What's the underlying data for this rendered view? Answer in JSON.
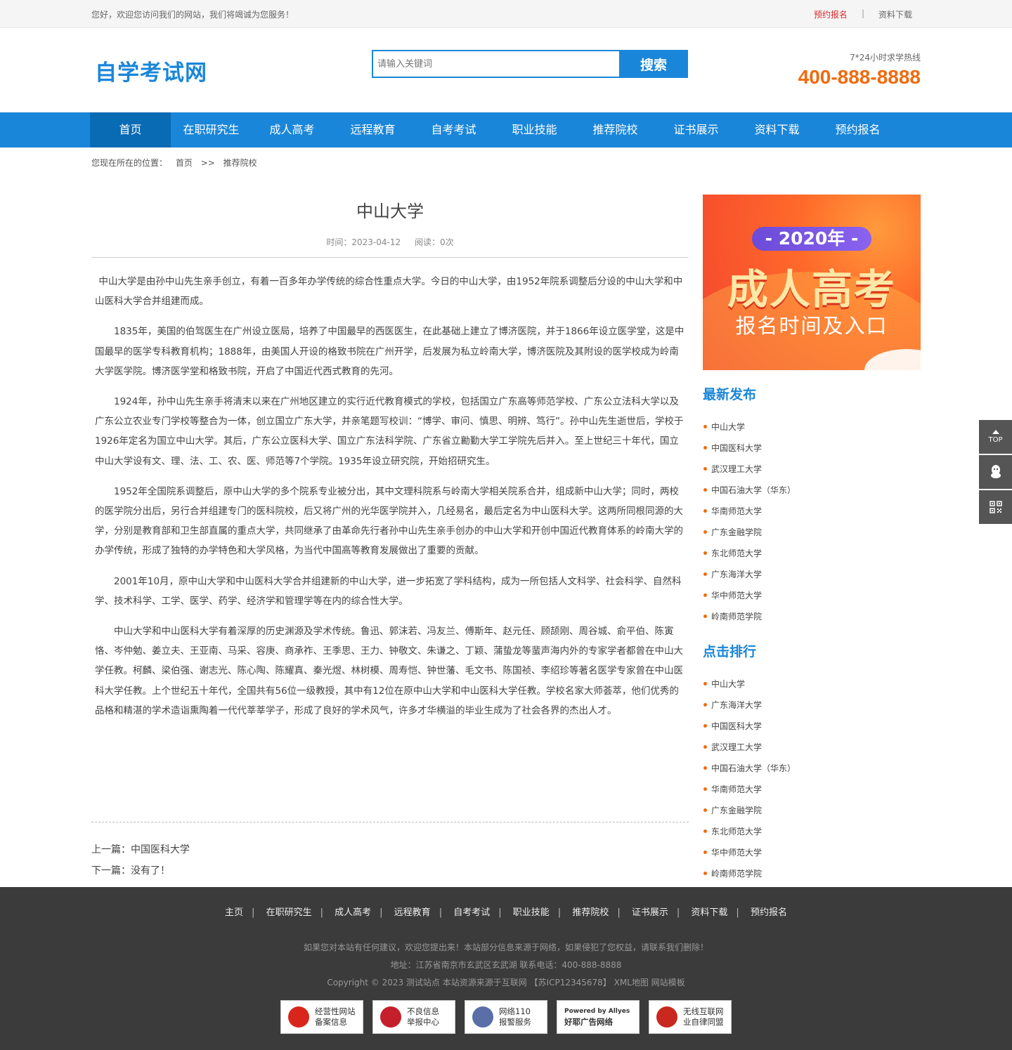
{
  "topbar": {
    "welcome": "您好，欢迎您访问我们的网站，我们将竭诚为您服务！",
    "link_signup": "预约报名",
    "separator": "|",
    "link_download": "资料下载"
  },
  "header": {
    "logo": "自学考试网",
    "search_placeholder": "请输入关键词",
    "search_button": "搜索",
    "hotline_label": "7*24小时求学热线",
    "hotline_number": "400-888-8888"
  },
  "nav": [
    "首页",
    "在职研究生",
    "成人高考",
    "远程教育",
    "自考考试",
    "职业技能",
    "推荐院校",
    "证书展示",
    "资料下载",
    "预约报名"
  ],
  "breadcrumb": {
    "prefix": "您现在所在的位置：",
    "home": "首页",
    "arrow": ">>",
    "current": "推荐院校"
  },
  "article": {
    "title": "中山大学",
    "time_label": "时间：2023-04-12",
    "views_label": "阅读：0次",
    "paragraphs": [
      "中山大学是由孙中山先生亲手创立，有着一百多年办学传统的综合性重点大学。今日的中山大学，由1952年院系调整后分设的中山大学和中山医科大学合并组建而成。",
      "1835年，美国的伯驾医生在广州设立医局，培养了中国最早的西医医生，在此基础上建立了博济医院，并于1866年设立医学堂，这是中国最早的医学专科教育机构；1888年，由美国人开设的格致书院在广州开学，后发展为私立岭南大学，博济医院及其附设的医学校成为岭南大学医学院。博济医学堂和格致书院，开启了中国近代西式教育的先河。",
      "1924年，孙中山先生亲手将清末以来在广州地区建立的实行近代教育模式的学校，包括国立广东高等师范学校、广东公立法科大学以及广东公立农业专门学校等整合为一体，创立国立广东大学，并亲笔题写校训：“博学、审问、慎思、明辨、笃行”。孙中山先生逝世后，学校于1926年定名为国立中山大学。其后，广东公立医科大学、国立广东法科学院、广东省立勷勤大学工学院先后并入。至上世纪三十年代，国立中山大学设有文、理、法、工、农、医、师范等7个学院。1935年设立研究院，开始招研究生。",
      "1952年全国院系调整后，原中山大学的多个院系专业被分出，其中文理科院系与岭南大学相关院系合并，组成新中山大学；同时，两校的医学院分出后，另行合并组建专门的医科院校，后又将广州的光华医学院并入，几经易名，最后定名为中山医科大学。这两所同根同源的大学，分别是教育部和卫生部直属的重点大学，共同继承了由革命先行者孙中山先生亲手创办的中山大学和开创中国近代教育体系的岭南大学的办学传统，形成了独特的办学特色和大学风格，为当代中国高等教育发展做出了重要的贡献。",
      "2001年10月，原中山大学和中山医科大学合并组建新的中山大学，进一步拓宽了学科结构，成为一所包括人文科学、社会科学、自然科学、技术科学、工学、医学、药学、经济学和管理学等在内的综合性大学。",
      "中山大学和中山医科大学有着深厚的历史渊源及学术传统。鲁迅、郭沫若、冯友兰、傅斯年、赵元任、顾颉刚、周谷城、俞平伯、陈寅恪、岑仲勉、姜立夫、王亚南、马采、容庚、商承祚、王季思、王力、钟敬文、朱谦之、丁颖、蒲蛰龙等蜚声海内外的专家学者都曾在中山大学任教。柯麟、梁伯强、谢志光、陈心陶、陈耀真、秦光煜、林树模、周寿恺、钟世藩、毛文书、陈国祯、李绍珍等著名医学专家曾在中山医科大学任教。上个世纪五十年代，全国共有56位一级教授，其中有12位在原中山大学和中山医科大学任教。学校名家大师荟萃，他们优秀的品格和精湛的学术造诣熏陶着一代代莘莘学子，形成了良好的学术风气，许多才华横溢的毕业生成为了社会各界的杰出人才。"
    ],
    "prev": "上一篇：中国医科大学",
    "next": "下一篇：没有了！"
  },
  "banner": {
    "year": "- 2020年 -",
    "headline": "成人高考",
    "subline": "报名时间及入口"
  },
  "sidebar": {
    "latest_title": "最新发布",
    "latest": [
      "中山大学",
      "中国医科大学",
      "武汉理工大学",
      "中国石油大学（华东）",
      "华南师范大学",
      "广东金融学院",
      "东北师范大学",
      "广东海洋大学",
      "华中师范大学",
      "岭南师范学院"
    ],
    "ranking_title": "点击排行",
    "ranking": [
      "中山大学",
      "广东海洋大学",
      "中国医科大学",
      "武汉理工大学",
      "中国石油大学（华东）",
      "华南师范大学",
      "广东金融学院",
      "东北师范大学",
      "华中师范大学",
      "岭南师范学院"
    ]
  },
  "float": {
    "top_label": "TOP",
    "icons": [
      "arrow-up-icon",
      "qq-icon",
      "qrcode-icon"
    ]
  },
  "footer": {
    "nav": [
      "主页",
      "在职研究生",
      "成人高考",
      "远程教育",
      "自考考试",
      "职业技能",
      "推荐院校",
      "证书展示",
      "资料下载",
      "预约报名"
    ],
    "notice": "如果您对本站有任何建议，欢迎您提出来！本站部分信息来源于网络，如果侵犯了您权益，请联系我们删除！",
    "address": "地址：江苏省南京市玄武区玄武湖    联系电话：400-888-8888",
    "copyright": "Copyright © 2023 测试站点 本站资源来源于互联网 【苏ICP12345678】 XML地图 网站模板",
    "badges": [
      {
        "line1": "经营性网站",
        "line2": "备案信息",
        "color": "#d8261c"
      },
      {
        "line1": "不良信息",
        "line2": "举报中心",
        "color": "#c41f2b"
      },
      {
        "line1": "网络110",
        "line2": "报警服务",
        "color": "#5a6fa8"
      },
      {
        "line1": "Powered by Allyes",
        "line2": "好耶广告网络",
        "color": "#222222"
      },
      {
        "line1": "无线互联网",
        "line2": "业自律同盟",
        "color": "#c8281e"
      }
    ]
  }
}
